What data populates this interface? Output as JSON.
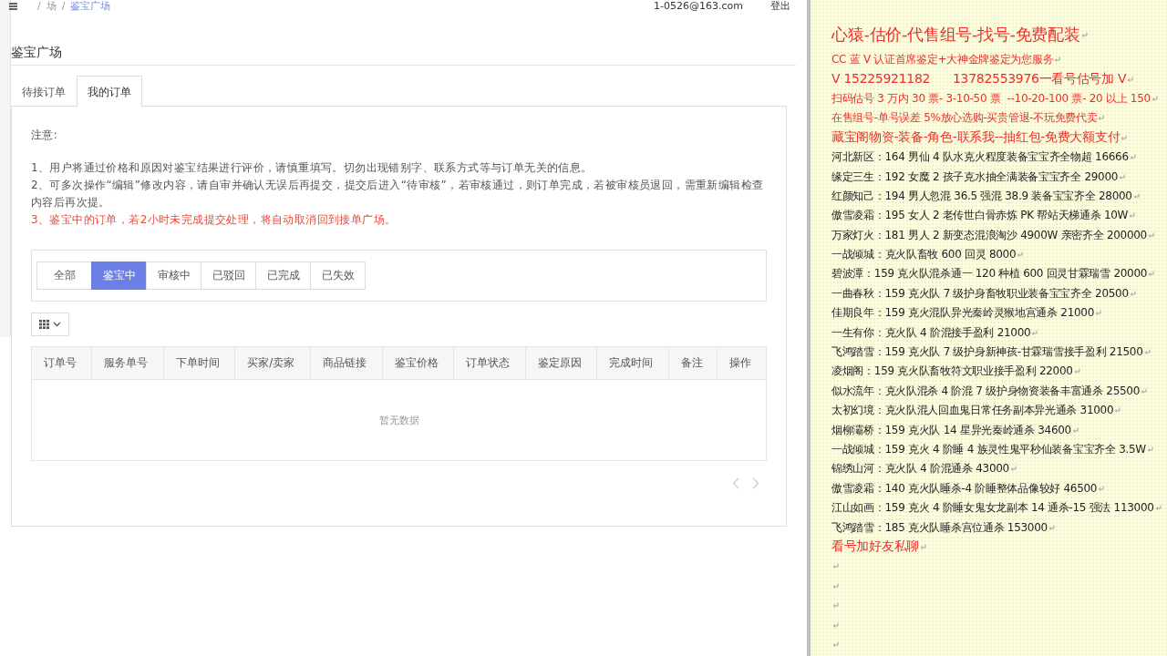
{
  "header": {
    "breadcrumb": [
      "/",
      "场",
      "/",
      "鉴宝广场"
    ],
    "user": "1-0526@163.com",
    "logout": "登出"
  },
  "page_title": "鉴宝广场",
  "tabs": [
    {
      "label": "待接订单",
      "selected": false
    },
    {
      "label": "我的订单",
      "selected": true
    }
  ],
  "notice": {
    "title": "注意:",
    "items": [
      {
        "text": "1、用户将通过价格和原因对鉴宝结果进行评价，请慎重填写。切勿出现错别字、联系方式等与订单无关的信息。",
        "kind": "normal"
      },
      {
        "text": "2、可多次操作“编辑”修改内容，请自审并确认无误后再提交，提交后进入“待审核”，若审核通过，则订单完成，若被审核员退回，需重新编辑检查内容后再次提。",
        "kind": "normal"
      },
      {
        "text": "3、鉴宝中的订单，若2小时未完成提交处理，将自动取消回到接单广场。",
        "kind": "warning"
      }
    ]
  },
  "filters": [
    {
      "label": "全部",
      "selected": false
    },
    {
      "label": "鉴宝中",
      "selected": true
    },
    {
      "label": "审核中",
      "selected": false
    },
    {
      "label": "已驳回",
      "selected": false
    },
    {
      "label": "已完成",
      "selected": false
    },
    {
      "label": "已失效",
      "selected": false
    }
  ],
  "table": {
    "columns": [
      "订单号",
      "服务单号",
      "下单时间",
      "买家/卖家",
      "商品链接",
      "鉴宝价格",
      "订单状态",
      "鉴定原因",
      "完成时间",
      "备注",
      "操作"
    ],
    "empty_text": "暂无数据"
  },
  "document": {
    "lines": [
      {
        "kind": "title",
        "text": "心猿-估价-代售组号-找号-免费配装"
      },
      {
        "kind": "red",
        "text": "CC 蓝 V 认证首席鉴定+大神金牌鉴定为您服务"
      },
      {
        "kind": "red-large",
        "text": "V 15225921182      13782553976一看号估号加 V"
      },
      {
        "kind": "red",
        "text": "扫码估号 3 万内 30 票- 3-10-50 票  --10-20-100 票- 20 以上 150"
      },
      {
        "kind": "red",
        "text": "在售组号-单号误差 5%放心选购-买贵管退-不玩免费代卖"
      },
      {
        "kind": "red-large",
        "text": "藏宝阁物资-装备-角色-联系我--抽红包-免费大额支付"
      },
      {
        "kind": "text",
        "text": "河北新区：164 男仙 4 队水克火程度装备宝宝齐全物超 16666"
      },
      {
        "kind": "text",
        "text": "缘定三生：192 女魔 2 孩子克水抽全满装备宝宝齐全 29000"
      },
      {
        "kind": "text",
        "text": "红颜知己：194 男人忽混 36.5 强混 38.9 装备宝宝齐全 28000"
      },
      {
        "kind": "text",
        "text": "傲雪凌霜：195 女人 2 老传世白骨赤炼 PK 帮站天梯通杀 10W"
      },
      {
        "kind": "text",
        "text": "万家灯火：181 男人 2 新变态混浪淘沙 4900W 亲密齐全 200000"
      },
      {
        "kind": "text",
        "text": "一战倾城：克火队畜牧 600 回灵 8000"
      },
      {
        "kind": "text",
        "text": "碧波潭：159 克火队混杀通一 120 种植 600 回灵甘霖瑞雪 20000"
      },
      {
        "kind": "text",
        "text": "一曲春秋：159 克火队 7 级护身畜牧职业装备宝宝齐全 20500"
      },
      {
        "kind": "text",
        "text": "佳期良年：159 克火混队异光秦岭灵猴地宫通杀 21000"
      },
      {
        "kind": "text",
        "text": "一生有你：克火队 4 阶混接手盈利 21000"
      },
      {
        "kind": "text",
        "text": "飞鸿踏雪：159 克火队 7 级护身新神孩-甘霖瑞雪接手盈利 21500"
      },
      {
        "kind": "text",
        "text": "凌烟阁：159 克火队畜牧符文职业接手盈利 22000"
      },
      {
        "kind": "text",
        "text": "似水流年：克火队混杀 4 阶混 7 级护身物资装备丰富通杀 25500"
      },
      {
        "kind": "text",
        "text": "太初幻境：克火队混人回血鬼日常任务副本异光通杀 31000"
      },
      {
        "kind": "text",
        "text": "烟柳灞桥：159 克火队 14 星异光秦岭通杀 34600"
      },
      {
        "kind": "text",
        "text": "一战倾城：159 克火 4 阶睡 4 族灵性鬼平秒仙装备宝宝齐全 3.5W"
      },
      {
        "kind": "text",
        "text": "锦绣山河：克火队 4 阶混通杀 43000"
      },
      {
        "kind": "text",
        "text": "傲雪凌霜：140 克火队睡杀-4 阶睡整体品像较好 46500"
      },
      {
        "kind": "text",
        "text": "江山如画：159 克火 4 阶睡女鬼女龙副本 14 通杀-15 强法 113000"
      },
      {
        "kind": "text",
        "text": "飞鸿踏雪：185 克火队睡杀宫位通杀 153000"
      },
      {
        "kind": "red-large",
        "text": "看号加好友私聊"
      },
      {
        "kind": "blank"
      },
      {
        "kind": "blank"
      },
      {
        "kind": "blank"
      },
      {
        "kind": "blank"
      },
      {
        "kind": "blank"
      }
    ]
  }
}
